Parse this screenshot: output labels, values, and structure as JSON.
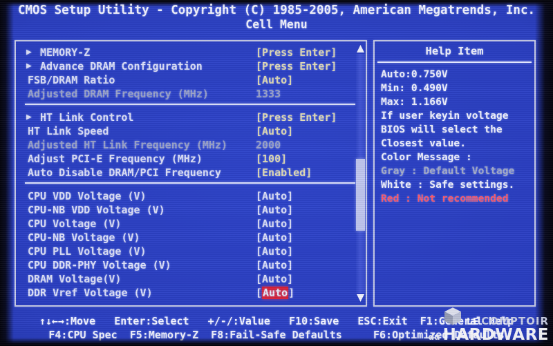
{
  "title": {
    "line1": "CMOS Setup Utility - Copyright (C) 1985-2005, American Megatrends, Inc.",
    "line2": "Cell Menu"
  },
  "help": {
    "header": "Help Item",
    "lines": [
      {
        "text": "Auto:0.750V",
        "color": "white"
      },
      {
        "text": "Min: 0.490V",
        "color": "white"
      },
      {
        "text": "Max: 1.166V",
        "color": "white"
      },
      {
        "text": "If user keyin voltage",
        "color": "white"
      },
      {
        "text": "BIOS will select the",
        "color": "white"
      },
      {
        "text": "Closest value.",
        "color": "white"
      },
      {
        "text": "Color Message :",
        "color": "white"
      },
      {
        "text": "Gray : Default Voltage",
        "color": "gray"
      },
      {
        "text": "White : Safe settings.",
        "color": "white"
      },
      {
        "text": "Red : Not recommended",
        "color": "red"
      }
    ]
  },
  "menu": {
    "groups": [
      {
        "rows": [
          {
            "label": "MEMORY-Z",
            "submenu": true,
            "label_color": "white",
            "value": "[Press Enter]",
            "value_color": "yellow"
          },
          {
            "label": "Advance DRAM Configuration",
            "submenu": true,
            "label_color": "white",
            "value": "[Press Enter]",
            "value_color": "yellow"
          },
          {
            "label": "FSB/DRAM Ratio",
            "submenu": false,
            "label_color": "white",
            "value": "[Auto]",
            "value_color": "yellow"
          },
          {
            "label": "Adjusted DRAM Frequency (MHz)",
            "submenu": false,
            "label_color": "gray",
            "value": "1333",
            "value_color": "gray"
          }
        ]
      },
      {
        "rows": [
          {
            "label": "HT Link Control",
            "submenu": true,
            "label_color": "white",
            "value": "[Press Enter]",
            "value_color": "yellow"
          },
          {
            "label": "HT Link Speed",
            "submenu": false,
            "label_color": "white",
            "value": "[Auto]",
            "value_color": "yellow"
          },
          {
            "label": "Adjusted HT Link Frequency (MHz)",
            "submenu": false,
            "label_color": "gray",
            "value": "2000",
            "value_color": "gray"
          },
          {
            "label": "Adjust PCI-E Frequency (MHz)",
            "submenu": false,
            "label_color": "white",
            "value": "[100]",
            "value_color": "yellow"
          },
          {
            "label": "Auto Disable DRAM/PCI Frequency",
            "submenu": false,
            "label_color": "white",
            "value": "[Enabled]",
            "value_color": "yellow"
          }
        ]
      },
      {
        "rows": [
          {
            "label": "CPU VDD Voltage (V)",
            "submenu": false,
            "label_color": "white",
            "value": "[Auto]",
            "value_color": "white"
          },
          {
            "label": "CPU-NB VDD Voltage (V)",
            "submenu": false,
            "label_color": "white",
            "value": "[Auto]",
            "value_color": "white"
          },
          {
            "label": "CPU Voltage (V)",
            "submenu": false,
            "label_color": "white",
            "value": "[Auto]",
            "value_color": "white"
          },
          {
            "label": "CPU-NB Voltage (V)",
            "submenu": false,
            "label_color": "white",
            "value": "[Auto]",
            "value_color": "white"
          },
          {
            "label": "CPU PLL Voltage (V)",
            "submenu": false,
            "label_color": "white",
            "value": "[Auto]",
            "value_color": "white"
          },
          {
            "label": "CPU DDR-PHY Voltage (V)",
            "submenu": false,
            "label_color": "white",
            "value": "[Auto]",
            "value_color": "white"
          },
          {
            "label": "DRAM Voltage(V)",
            "submenu": false,
            "label_color": "white",
            "value": "[Auto]",
            "value_color": "white"
          },
          {
            "label": "DDR Vref Voltage (V)",
            "submenu": false,
            "label_color": "white",
            "value": "[Auto]",
            "value_color": "white",
            "selected": true,
            "highlight_text": "Auto"
          }
        ]
      }
    ]
  },
  "scrollbar": {
    "up_arrow": "scroll-up-arrow",
    "down_arrow": "scroll-down-arrow"
  },
  "hints": {
    "line1": "↑↓←→:Move   Enter:Select   +/-/:Value   F10:Save   ESC:Exit  F1:General Help",
    "line2": "F4:CPU Spec  F5:Memory-Z  F8:Fail-Safe Defaults     F6:Optimized Defaults"
  },
  "watermark": {
    "le": "LE",
    "comptoir": "COMPTOIR",
    "du": "du",
    "hardware": "HARDWARE"
  },
  "colors": {
    "background_blue": "#2b3fc2",
    "panel_border": "#c9cde9",
    "value_yellow": "#f6eeb4",
    "label_white": "#f2f3ff",
    "label_gray": "#a7aec9",
    "highlight_red": "#f02029",
    "help_red": "#ff5a6e"
  }
}
